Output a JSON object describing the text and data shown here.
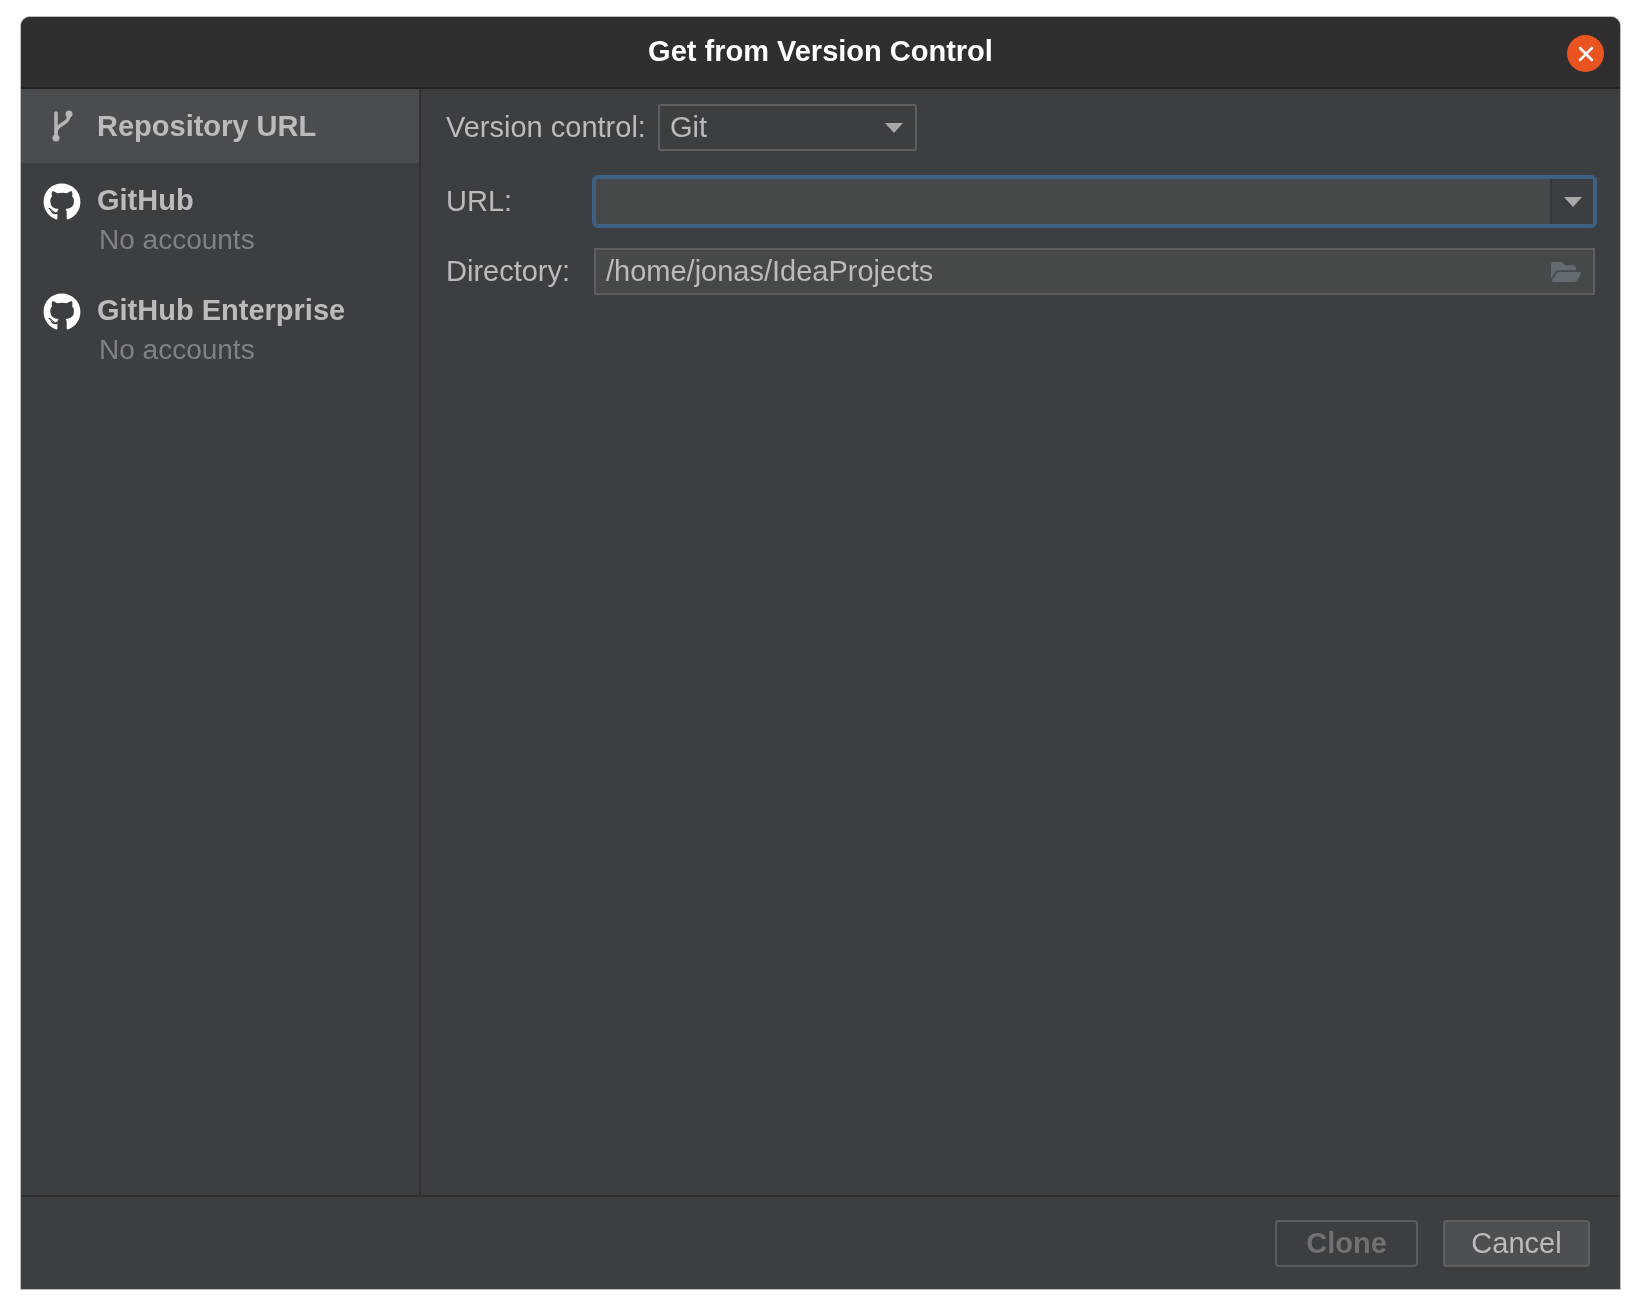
{
  "window": {
    "title": "Get from Version Control"
  },
  "sidebar": {
    "items": [
      {
        "label": "Repository URL",
        "kind": "branch",
        "selected": true
      },
      {
        "label": "GitHub",
        "kind": "github",
        "selected": false,
        "subtitle": "No accounts"
      },
      {
        "label": "GitHub Enterprise",
        "kind": "github",
        "selected": false,
        "subtitle": "No accounts"
      }
    ]
  },
  "form": {
    "version_control": {
      "label": "Version control:",
      "value": "Git"
    },
    "url": {
      "label": "URL:",
      "focused": true
    },
    "directory": {
      "label": "Directory:",
      "value": "/home/jonas/IdeaProjects"
    }
  },
  "buttons": [
    {
      "label": "Clone",
      "disabled": true
    },
    {
      "label": "Cancel",
      "disabled": false
    }
  ]
}
